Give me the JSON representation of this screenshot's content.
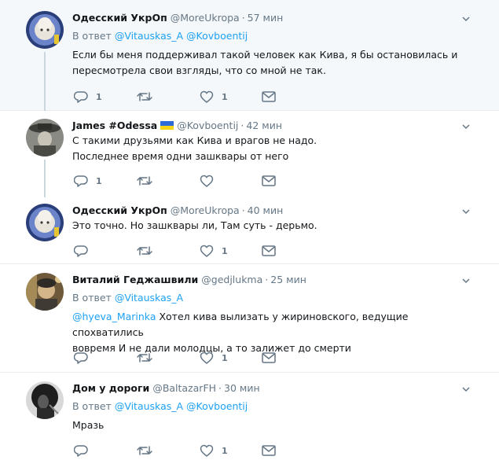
{
  "tweets": [
    {
      "name": "Одесский УкрОп",
      "handle": "@MoreUkropa",
      "time": "57 мин",
      "reply_prefix": "В ответ",
      "reply_to_1": "@Vitauskas_A",
      "reply_to_2": "@Kovboentij",
      "text_line_1": "Если бы меня поддерживал такой человек как Кива, я бы остановилась и",
      "text_line_2": "пересмотрела свои взгляды, что со мной не так.",
      "reply_count": "1",
      "retweet_count": "",
      "like_count": "1"
    },
    {
      "name": "James #Odessa",
      "handle": "@Kovboentij",
      "time": "42 мин",
      "text_line_1": "С такими друзьями как Кива и врагов не надо.",
      "text_line_2": "Последнее время одни зашквары от него",
      "reply_count": "1",
      "retweet_count": "",
      "like_count": ""
    },
    {
      "name": "Одесский УкрОп",
      "handle": "@MoreUkropa",
      "time": "40 мин",
      "text_line_1": "Это точно. Но зашквары ли, Там суть - дерьмо.",
      "reply_count": "",
      "retweet_count": "",
      "like_count": "1"
    },
    {
      "name": "Виталий Геджашвили",
      "handle": "@gedjlukma",
      "time": "25 мин",
      "reply_prefix": "В ответ",
      "reply_to_1": "@Vitauskas_A",
      "mention": "@hyeva_Marinka",
      "text_line_1_rest": " Хотел кива вылизать у жириновского, ведущие спохватились",
      "text_line_2": "вовремя И не дали молодцы, а то залижет до смерти",
      "reply_count": "",
      "retweet_count": "",
      "like_count": "1"
    },
    {
      "name": "Дом у дороги",
      "handle": "@BaltazarFH",
      "time": "30 мин",
      "reply_prefix": "В ответ",
      "reply_to_1": "@Vitauskas_A",
      "reply_to_2": "@Kovboentij",
      "text_line_1": "Мразь",
      "reply_count": "",
      "retweet_count": "",
      "like_count": "1"
    }
  ],
  "colors": {
    "accent": "#1da1f2",
    "secondary_text": "#657786",
    "highlight_bg": "#f5f8fa"
  },
  "icons": [
    "reply-icon",
    "retweet-icon",
    "like-icon",
    "direct-message-icon",
    "chevron-down-icon"
  ]
}
